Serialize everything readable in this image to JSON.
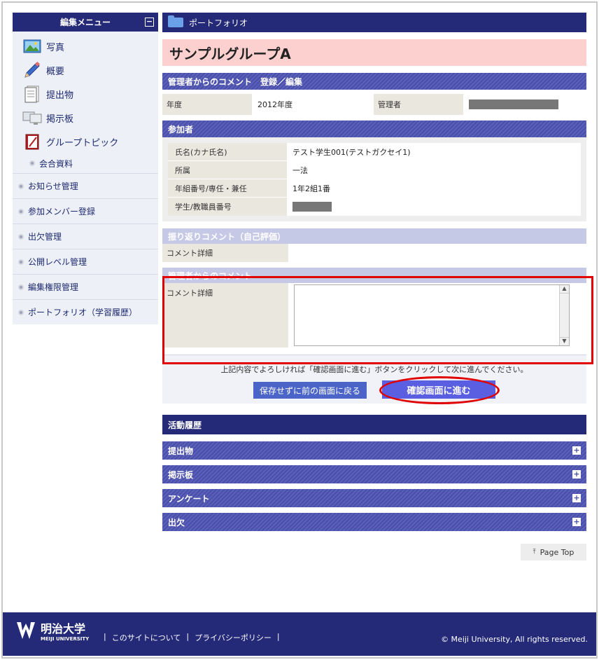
{
  "sidebar": {
    "header": "編集メニュー",
    "collapse_symbol": "⊟",
    "features": [
      {
        "label": "写真",
        "icon": "photo-icon"
      },
      {
        "label": "概要",
        "icon": "pencil-icon"
      },
      {
        "label": "提出物",
        "icon": "document-icon"
      },
      {
        "label": "掲示板",
        "icon": "monitor-icon"
      },
      {
        "label": "グループトピック",
        "icon": "notebook-icon"
      }
    ],
    "sub_item": "会合資料",
    "links": [
      "お知らせ管理",
      "参加メンバー登録",
      "出欠管理",
      "公開レベル管理",
      "編集権限管理",
      "ポートフォリオ（学習履歴）"
    ]
  },
  "main": {
    "breadcrumb": "ポートフォリオ",
    "group_name": "サンプルグループA",
    "admin_section_title": "管理者からのコメント　登録／編集",
    "year_label": "年度",
    "year_value": "2012年度",
    "manager_label": "管理者",
    "participants_title": "参加者",
    "participant_rows": [
      {
        "label": "氏名(カナ氏名)",
        "value": "テスト学生001(テストガクセイ1)"
      },
      {
        "label": "所属",
        "value": "一法"
      },
      {
        "label": "年組番号/専任・兼任",
        "value": "1年2組1番"
      },
      {
        "label": "学生/教職員番号",
        "value": ""
      }
    ],
    "reflection_title": "振り返りコメント（自己評価）",
    "reflection_detail_label": "コメント詳細",
    "admin_comment_title": "管理者からのコメント",
    "admin_comment_detail_label": "コメント詳細",
    "admin_comment_value": "",
    "instruction": "上記内容でよろしければ「確認画面に進む」ボタンをクリックして次に進んでください。",
    "back_button": "保存せずに前の画面に戻る",
    "confirm_button": "確認画面に進む",
    "history_title": "活動履歴",
    "history_items": [
      "提出物",
      "掲示板",
      "アンケート",
      "出欠"
    ],
    "page_top": "Page Top"
  },
  "footer": {
    "logo_text": "明治大学",
    "logo_sub": "MEIJI UNIVERSITY",
    "links": [
      "このサイトについて",
      "プライバシーポリシー"
    ],
    "copyright": "© Meiji University, All rights reserved."
  },
  "colors": {
    "navy": "#242a78",
    "stripe": "#5b60b8",
    "highlight_red": "#e00000",
    "group_pink": "#fdd0d0",
    "confirm_blue": "#5a5ee0"
  }
}
